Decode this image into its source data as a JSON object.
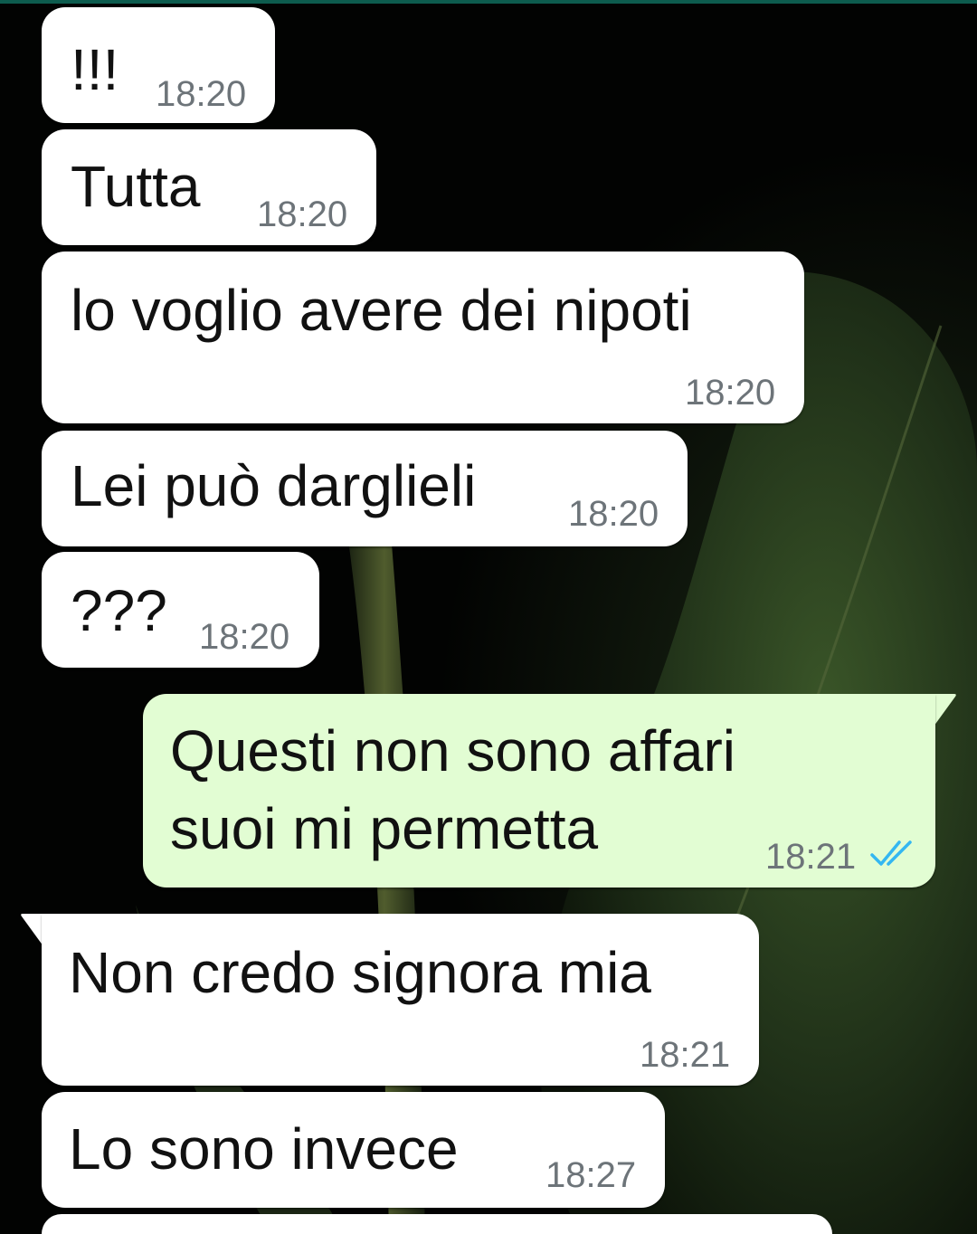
{
  "chat": {
    "messages": [
      {
        "text": "!!!",
        "time": "18:20",
        "direction": "incoming"
      },
      {
        "text": "Tutta",
        "time": "18:20",
        "direction": "incoming"
      },
      {
        "text": "lo voglio avere dei nipoti",
        "time": "18:20",
        "direction": "incoming"
      },
      {
        "text": "Lei può darglieli",
        "time": "18:20",
        "direction": "incoming"
      },
      {
        "text": "???",
        "time": "18:20",
        "direction": "incoming"
      },
      {
        "text_line1": "Questi non sono affari",
        "text_line2": "suoi mi permetta",
        "time": "18:21",
        "direction": "outgoing",
        "status": "read"
      },
      {
        "text": "Non credo signora mia",
        "time": "18:21",
        "direction": "incoming"
      },
      {
        "text": "Lo sono invece",
        "time": "18:27",
        "direction": "incoming"
      }
    ]
  },
  "colors": {
    "incoming_bubble": "#ffffff",
    "outgoing_bubble": "#e2fdd3",
    "read_ticks": "#34b7f1",
    "timestamp": "#6d7479",
    "header_accent": "#0d5c4e"
  },
  "icons": {
    "read_receipt": "double-check-icon"
  }
}
